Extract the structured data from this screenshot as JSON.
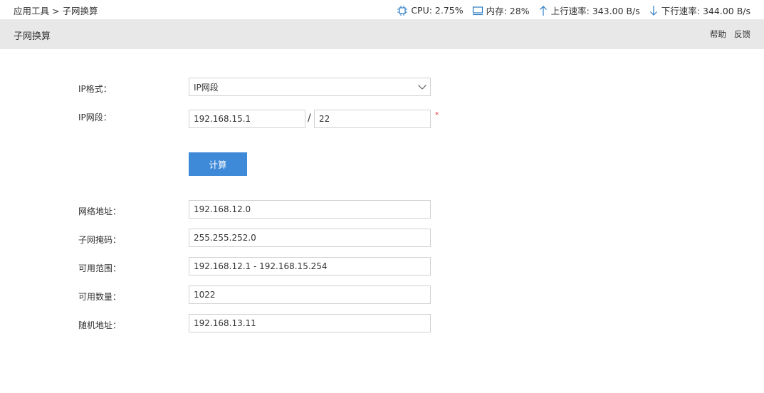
{
  "breadcrumb": {
    "parent": "应用工具",
    "separator": ">",
    "current": "子网换算"
  },
  "stats": {
    "cpu": "CPU: 2.75%",
    "memory": "内存: 28%",
    "upload": "上行速率: 343.00 B/s",
    "download": "下行速率: 344.00 B/s"
  },
  "header": {
    "title": "子网换算",
    "help": "帮助",
    "feedback": "反馈"
  },
  "form": {
    "ip_format_label": "IP格式：",
    "ip_format_value": "IP网段",
    "ip_segment_label": "IP网段：",
    "ip_value": "192.168.15.1",
    "slash": "/",
    "prefix_value": "22",
    "required_mark": "*",
    "calculate_label": "计算"
  },
  "results": {
    "network_label": "网络地址：",
    "network_value": "192.168.12.0",
    "mask_label": "子网掩码：",
    "mask_value": "255.255.252.0",
    "range_label": "可用范围：",
    "range_value": "192.168.12.1 - 192.168.15.254",
    "count_label": "可用数量：",
    "count_value": "1022",
    "random_label": "随机地址：",
    "random_value": "192.168.13.11"
  },
  "colors": {
    "accent": "#3f8ad8",
    "header_bg": "#e8e8e8",
    "required": "#e4393c",
    "icon": "#2a7bc4"
  }
}
